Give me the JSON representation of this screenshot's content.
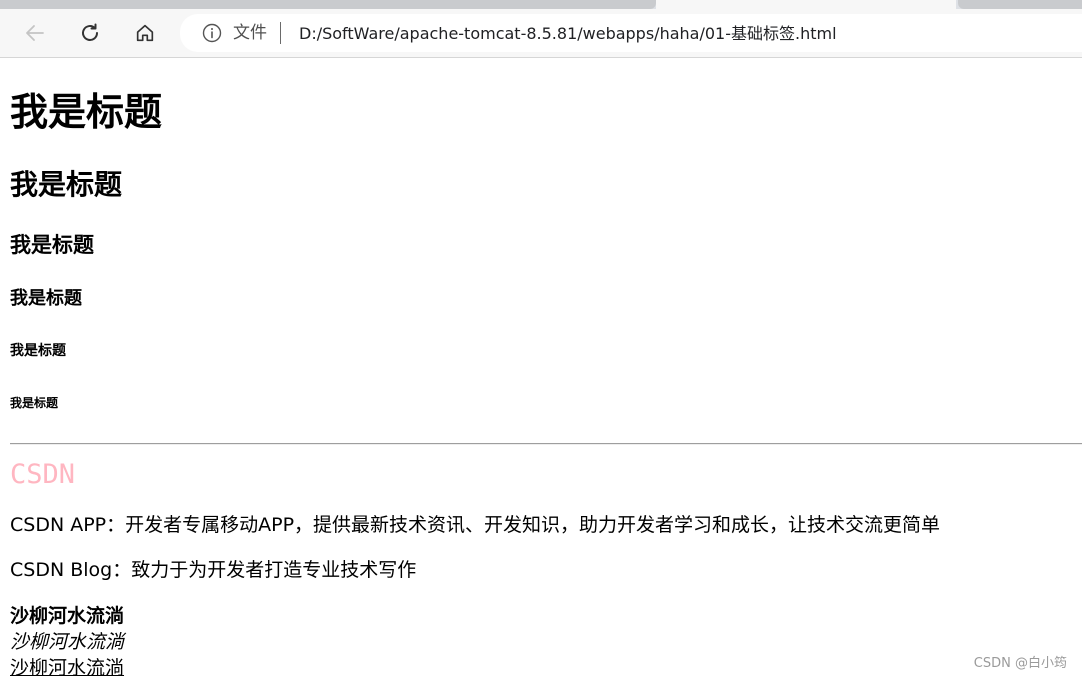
{
  "browser": {
    "address": {
      "file_label": "文件",
      "url": "D:/SoftWare/apache-tomcat-8.5.81/webapps/haha/01-基础标签.html"
    },
    "icons": {
      "back": "arrow-left-icon",
      "reload": "reload-icon",
      "home": "home-icon",
      "info": "info-icon"
    }
  },
  "page": {
    "headings": {
      "h1": "我是标题",
      "h2": "我是标题",
      "h3": "我是标题",
      "h4": "我是标题",
      "h5": "我是标题",
      "h6": "我是标题"
    },
    "csdn_title": "CSDN",
    "csdn_title_color": "#ffb6c1",
    "paragraph_app": "CSDN APP：开发者专属移动APP，提供最新技术资讯、开发知识，助力开发者学习和成长，让技术交流更简单",
    "paragraph_blog": "CSDN Blog：致力于为开发者打造专业技术写作",
    "bold_text": "沙柳河水流淌",
    "italic_text": "沙柳河水流淌",
    "underline_text": "沙柳河水流淌"
  },
  "watermark": "CSDN @白小筠"
}
